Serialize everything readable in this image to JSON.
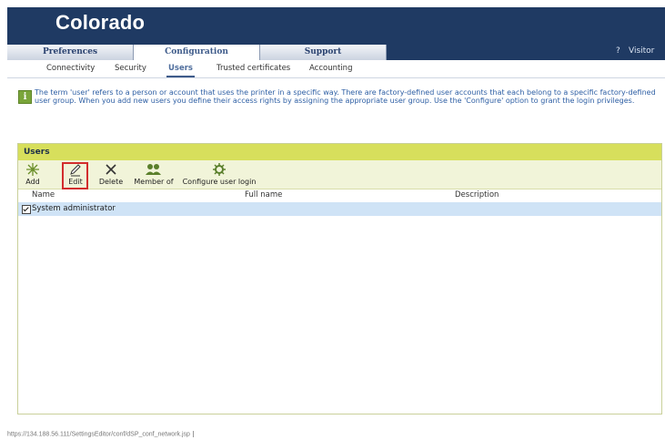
{
  "app": {
    "title": "Colorado"
  },
  "tabs": [
    {
      "label": "Preferences",
      "active": false
    },
    {
      "label": "Configuration",
      "active": true
    },
    {
      "label": "Support",
      "active": false
    }
  ],
  "header_right": {
    "help": "?",
    "user": "Visitor"
  },
  "subnav": [
    {
      "label": "Connectivity",
      "active": false
    },
    {
      "label": "Security",
      "active": false
    },
    {
      "label": "Users",
      "active": true
    },
    {
      "label": "Trusted certificates",
      "active": false
    },
    {
      "label": "Accounting",
      "active": false
    }
  ],
  "info": {
    "icon": "info-icon",
    "text": "The term 'user' refers to a person or account that uses the printer in a specific way. There are factory-defined user accounts that each belong to a specific factory-defined user group. When you add new users you define their access rights by assigning the appropriate user group. Use the 'Configure' option to grant the login privileges."
  },
  "users_panel": {
    "title": "Users",
    "toolbar": [
      {
        "label": "Add",
        "icon": "add-user-icon"
      },
      {
        "label": "Edit",
        "icon": "edit-pencil-icon",
        "highlighted": true
      },
      {
        "label": "Delete",
        "icon": "delete-x-icon"
      },
      {
        "label": "Member of",
        "icon": "group-members-icon"
      },
      {
        "label": "Configure user login",
        "icon": "configure-login-icon"
      }
    ],
    "columns": [
      "Name",
      "Full name",
      "Description"
    ],
    "rows": [
      {
        "name": "System administrator",
        "full_name": "",
        "description": "",
        "checked": true
      }
    ]
  },
  "status_bar": {
    "url": "https://134.188.56.111/SettingsEditor/conf/dSP_conf_network.jsp"
  },
  "colors": {
    "header_bg": "#1f3a63",
    "panel_header": "#d7df5c",
    "toolbar_bg": "#f1f4d9",
    "selected_row": "#cfe3f6",
    "info_text": "#2e5fa4",
    "highlight_border": "#d22d2d"
  }
}
